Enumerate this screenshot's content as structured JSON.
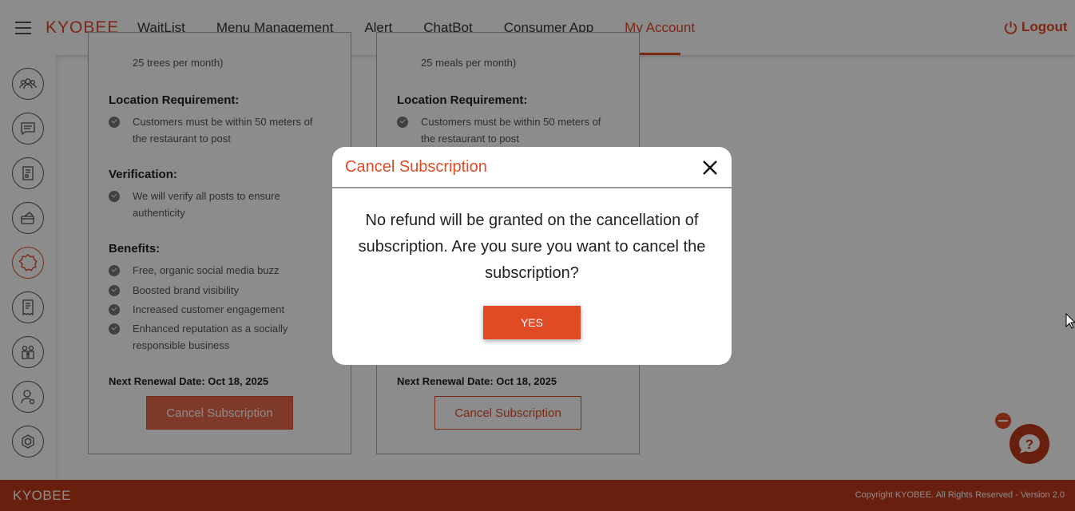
{
  "header": {
    "logo": "KYOBEE",
    "nav": [
      "WaitList",
      "Menu Management",
      "Alert",
      "ChatBot",
      "Consumer App",
      "My Account"
    ],
    "active_nav": "My Account",
    "logout_label": "Logout"
  },
  "sidebar": {
    "icons": [
      "group-icon",
      "chat-icon",
      "document-icon",
      "payment-icon",
      "badge-icon",
      "receipt-icon",
      "family-icon",
      "user-settings-icon",
      "hexagon-icon"
    ],
    "active_index": 4
  },
  "cards": [
    {
      "fragment": "25 trees per month)",
      "location_title": "Location Requirement:",
      "location_text": "Customers must be within 50 meters of the restaurant to post",
      "verification_title": "Verification:",
      "verification_text": "We will verify all posts to ensure authenticity",
      "benefits_title": "Benefits:",
      "benefits": [
        "Free, organic social media buzz",
        "Boosted brand visibility",
        "Increased customer engagement",
        "Enhanced reputation as a socially responsible business"
      ],
      "renewal": "Next Renewal Date: Oct 18, 2025",
      "cancel_label": "Cancel Subscription"
    },
    {
      "fragment": "25 meals per month)",
      "location_title": "Location Requirement:",
      "location_text": "Customers must be within 50 meters of the restaurant to post",
      "renewal": "Next Renewal Date: Oct 18, 2025",
      "cancel_label": "Cancel Subscription"
    }
  ],
  "modal": {
    "title": "Cancel Subscription",
    "message": "No refund will be granted on the cancellation of subscription. Are you sure you want to cancel the subscription?",
    "yes_label": "YES"
  },
  "footer": {
    "logo": "KYOBEE",
    "copyright": "Copyright KYOBEE. All Rights Reserved - Version 2.0"
  },
  "colors": {
    "accent": "#e04a25",
    "footer": "#c0391b"
  }
}
